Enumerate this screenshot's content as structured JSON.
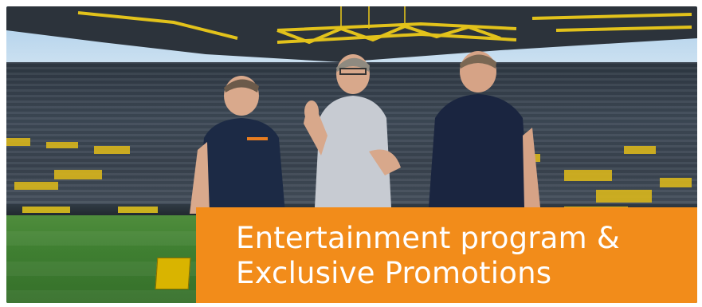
{
  "caption": {
    "line1": "Entertainment program &",
    "line2": "Exclusive Promotions"
  },
  "colors": {
    "caption_bg": "#f28c1a",
    "caption_text": "#ffffff",
    "stadium_yellow": "#e8c81a",
    "pitch_green": "#3f7f31"
  },
  "photo": {
    "people": [
      "man-in-navy-polo-left",
      "man-in-grey-polo-thumbs-up",
      "man-in-navy-polo-right"
    ]
  }
}
